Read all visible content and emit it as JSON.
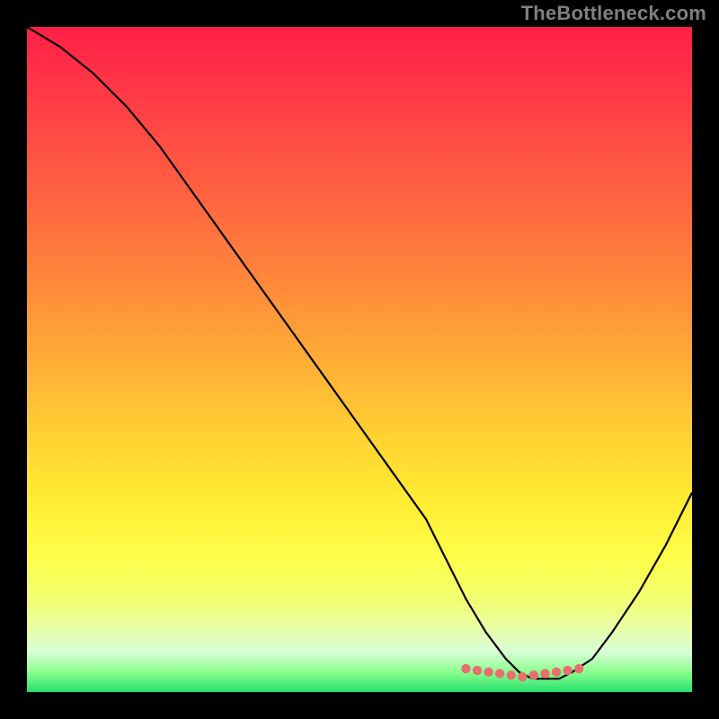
{
  "watermark": "TheBottleneck.com",
  "colors": {
    "page_bg": "#000000",
    "line": "#000000",
    "dots": "#e76f6f",
    "watermark": "#808080"
  },
  "chart_data": {
    "type": "line",
    "title": "",
    "xlabel": "",
    "ylabel": "",
    "xlim": [
      0,
      100
    ],
    "ylim": [
      0,
      100
    ],
    "grid": false,
    "legend": false,
    "series": [
      {
        "name": "bottleneck-curve",
        "x": [
          0,
          5,
          10,
          15,
          20,
          25,
          30,
          35,
          40,
          45,
          50,
          55,
          60,
          63,
          66,
          69,
          72,
          74,
          76,
          78,
          80,
          82,
          85,
          88,
          92,
          96,
          100
        ],
        "y": [
          100,
          97,
          93,
          88,
          82,
          75,
          68,
          61,
          54,
          47,
          40,
          33,
          26,
          20,
          14,
          9,
          5,
          3,
          2,
          2,
          2,
          3,
          5,
          9,
          15,
          22,
          30
        ]
      }
    ],
    "dot_band": {
      "name": "optimal-range-dots",
      "x_start": 66,
      "x_end": 83,
      "y": 2.3,
      "count": 11
    }
  }
}
